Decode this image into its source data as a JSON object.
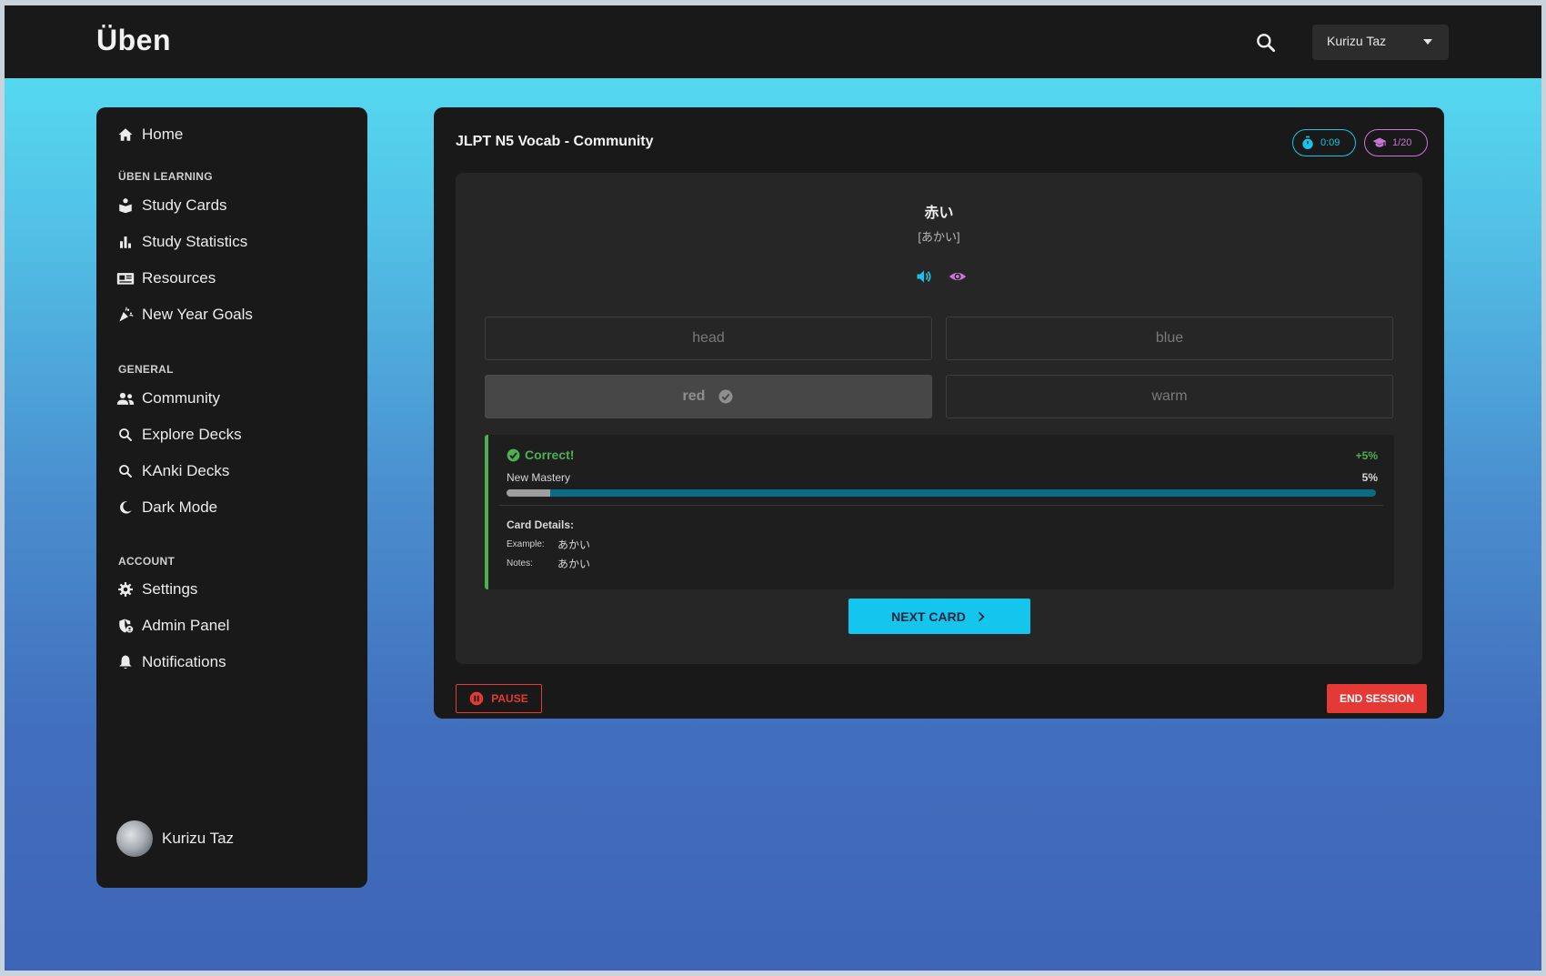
{
  "app": {
    "brand": "Üben"
  },
  "header": {
    "user_name": "Kurizu Taz"
  },
  "sidebar": {
    "home": "Home",
    "sections": {
      "learning": "ÜBEN LEARNING",
      "general": "GENERAL",
      "account": "ACCOUNT"
    },
    "learning_items": [
      "Study Cards",
      "Study Statistics",
      "Resources",
      "New Year Goals"
    ],
    "general_items": [
      "Community",
      "Explore Decks",
      "KAnki Decks",
      "Dark Mode"
    ],
    "account_items": [
      "Settings",
      "Admin Panel",
      "Notifications"
    ],
    "user_name": "Kurizu Taz"
  },
  "session": {
    "title": "JLPT N5 Vocab - Community",
    "timer": "0:09",
    "progress": "1/20",
    "colors": {
      "timer": "#18c4e8",
      "progress": "#c878d4"
    }
  },
  "card": {
    "word": "赤い",
    "reading": "[あかい]",
    "options": [
      {
        "label": "head",
        "selected": false
      },
      {
        "label": "blue",
        "selected": false
      },
      {
        "label": "red",
        "selected": true
      },
      {
        "label": "warm",
        "selected": false
      }
    ]
  },
  "feedback": {
    "status": "Correct!",
    "mastery_gain": "+5%",
    "mastery_label": "New Mastery",
    "mastery_value": "5%",
    "mastery_fraction": 0.05,
    "details_title": "Card Details:",
    "example_label": "Example:",
    "example_value": "あかい",
    "notes_label": "Notes:",
    "notes_value": "あかい",
    "color": "#4caf50"
  },
  "actions": {
    "next_label": "NEXT CARD",
    "pause_label": "PAUSE",
    "end_label": "END SESSION"
  }
}
